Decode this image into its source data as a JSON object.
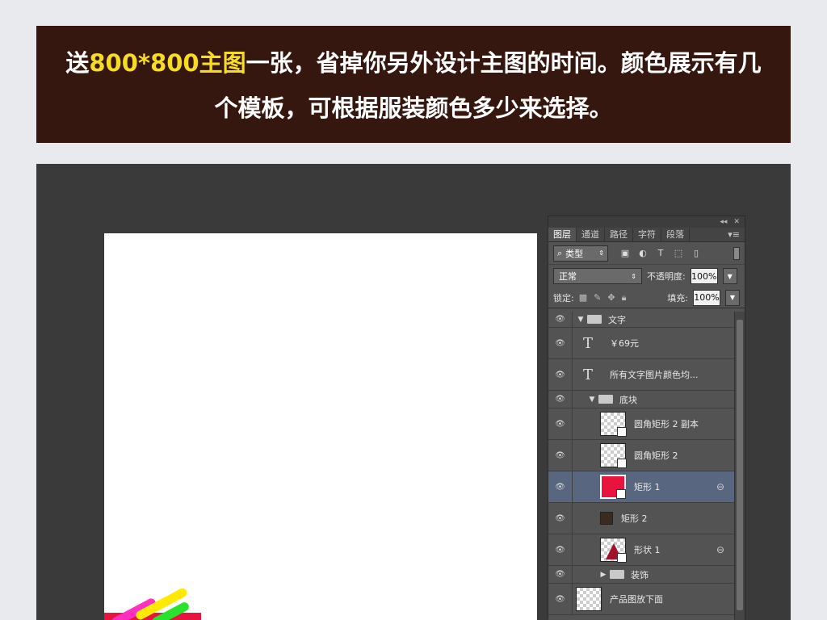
{
  "banner": {
    "line1_pre": "送",
    "line1_highlight": "800*800主图",
    "line1_post": "一张，省掉你另外设计主图的时间。颜色展示有几",
    "line2": "个模板，可根据服装颜色多少来选择。"
  },
  "layers_panel": {
    "tabs": [
      "图层",
      "通道",
      "路径",
      "字符",
      "段落"
    ],
    "filter_label": "类型",
    "blend_mode": "正常",
    "opacity_label": "不透明度:",
    "opacity_value": "100%",
    "lock_label": "锁定:",
    "fill_label": "填充:",
    "fill_value": "100%",
    "layers": [
      {
        "name": "文字",
        "kind": "group",
        "expanded": true
      },
      {
        "name": "￥69元",
        "kind": "text"
      },
      {
        "name": "所有文字图片颜色均...",
        "kind": "text"
      },
      {
        "name": "底块",
        "kind": "group",
        "expanded": true
      },
      {
        "name": "圆角矩形 2 副本",
        "kind": "shape"
      },
      {
        "name": "圆角矩形 2",
        "kind": "shape"
      },
      {
        "name": "矩形 1",
        "kind": "shape",
        "selected": true,
        "linked": true
      },
      {
        "name": "矩形 2",
        "kind": "shape"
      },
      {
        "name": "形状 1",
        "kind": "shape",
        "linked": true
      },
      {
        "name": "装饰",
        "kind": "group",
        "expanded": false
      },
      {
        "name": "产品图放下面",
        "kind": "pixel"
      }
    ]
  },
  "colors": {
    "banner_bg": "#36170f",
    "highlight": "#f6dc22",
    "selected_layer": "#58677f",
    "rect1_fill": "#e8133f"
  }
}
